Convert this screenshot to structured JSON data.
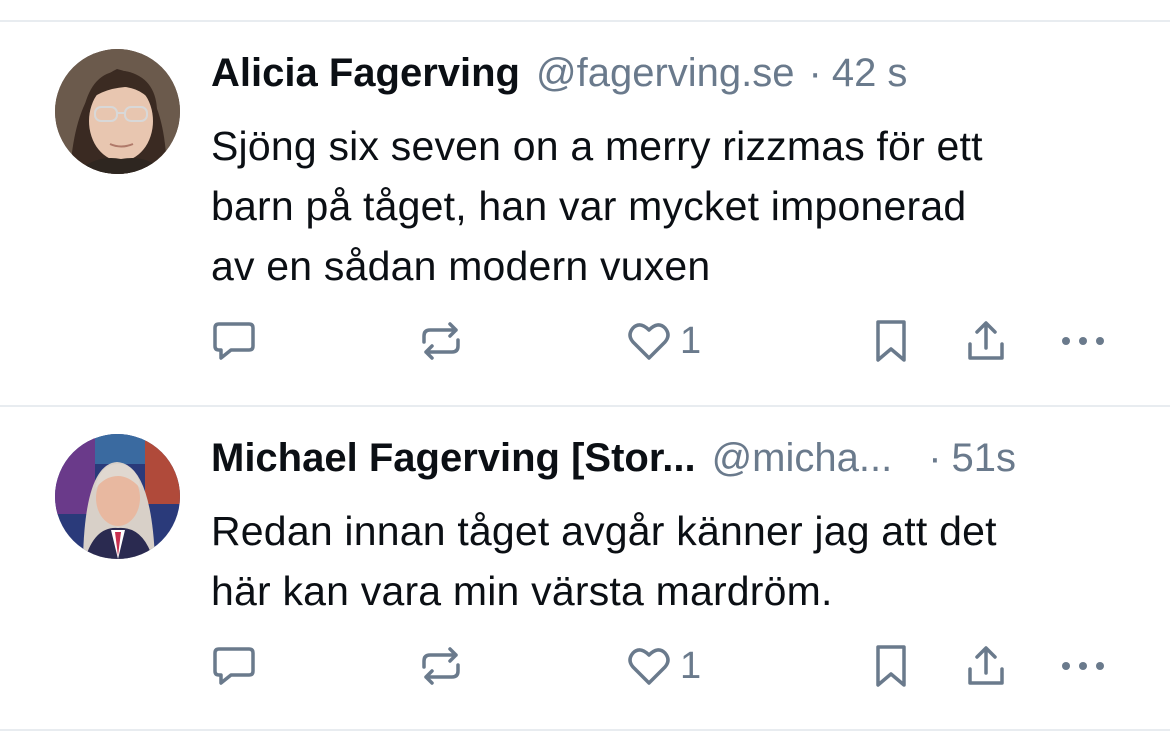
{
  "posts": [
    {
      "author": "Alicia Fagerving",
      "handle": "@fagerving.se",
      "time": "42 s",
      "text_lines": [
        "Sjöng six seven on a merry rizzmas för ett",
        "barn på tåget, han var mycket imponerad",
        "av en sådan modern vuxen"
      ],
      "like_count": "1",
      "avatar_icon": "person-with-glasses"
    },
    {
      "author": "Michael Fagerving [Stor...",
      "handle": "@micha...",
      "time": "51s",
      "text_lines": [
        "Redan innan tåget avgår känner jag att det",
        "här kan vara min värsta mardröm."
      ],
      "like_count": "1",
      "avatar_icon": "person-in-suit"
    }
  ],
  "icons": {
    "reply": "speech-bubble-icon",
    "repost": "repost-arrows-icon",
    "like": "heart-icon",
    "bookmark": "bookmark-icon",
    "share": "share-upload-icon",
    "more": "more-dots-icon"
  },
  "colors": {
    "icon": "#6a7a8c",
    "text": "#0b0f14",
    "meta": "#6a7a8c",
    "divider": "#e8ecf0"
  }
}
